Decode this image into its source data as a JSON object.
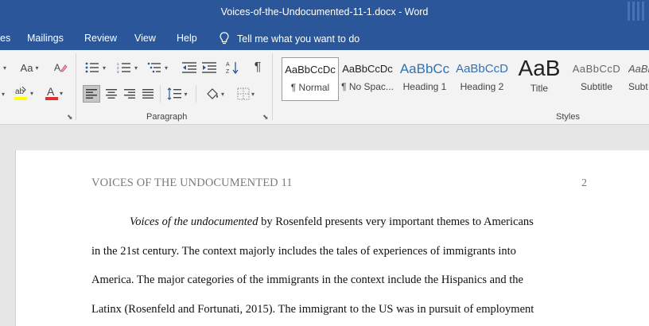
{
  "window": {
    "title": "Voices-of-the-Undocumented-11-1.docx  -  Word"
  },
  "tabs": [
    {
      "label": "es"
    },
    {
      "label": "Mailings"
    },
    {
      "label": "Review"
    },
    {
      "label": "View"
    },
    {
      "label": "Help"
    }
  ],
  "tell_me": {
    "placeholder": "Tell me what you want to do"
  },
  "ribbon": {
    "font_case_label": "Aa",
    "paragraph_label": "Paragraph",
    "styles_label": "Styles",
    "colors": {
      "highlight": "#ffff00",
      "font_color": "#e03030",
      "accent": "#2b579a"
    },
    "styles": [
      {
        "sample": "AaBbCcDc",
        "name": "¶ Normal"
      },
      {
        "sample": "AaBbCcDc",
        "name": "¶ No Spac..."
      },
      {
        "sample": "AaBbCc",
        "name": "Heading 1"
      },
      {
        "sample": "AaBbCcD",
        "name": "Heading 2"
      },
      {
        "sample": "AaB",
        "name": "Title"
      },
      {
        "sample": "AaBbCcD",
        "name": "Subtitle"
      },
      {
        "sample": "AaBb",
        "name": "Subt"
      }
    ]
  },
  "document": {
    "header": "VOICES OF THE UNDOCUMENTED 11",
    "page_number": "2",
    "first_line": {
      "italic": "Voices of the undocumented",
      "rest": " by Rosenfeld presents very important themes to Americans"
    },
    "lines": [
      "in the 21st century. The context majorly includes the tales of experiences of immigrants into",
      "America. The major categories of the immigrants in the context include the Hispanics and the",
      "Latinx (Rosenfeld and Fortunati, 2015). The immigrant to the US was in pursuit of employment"
    ]
  }
}
